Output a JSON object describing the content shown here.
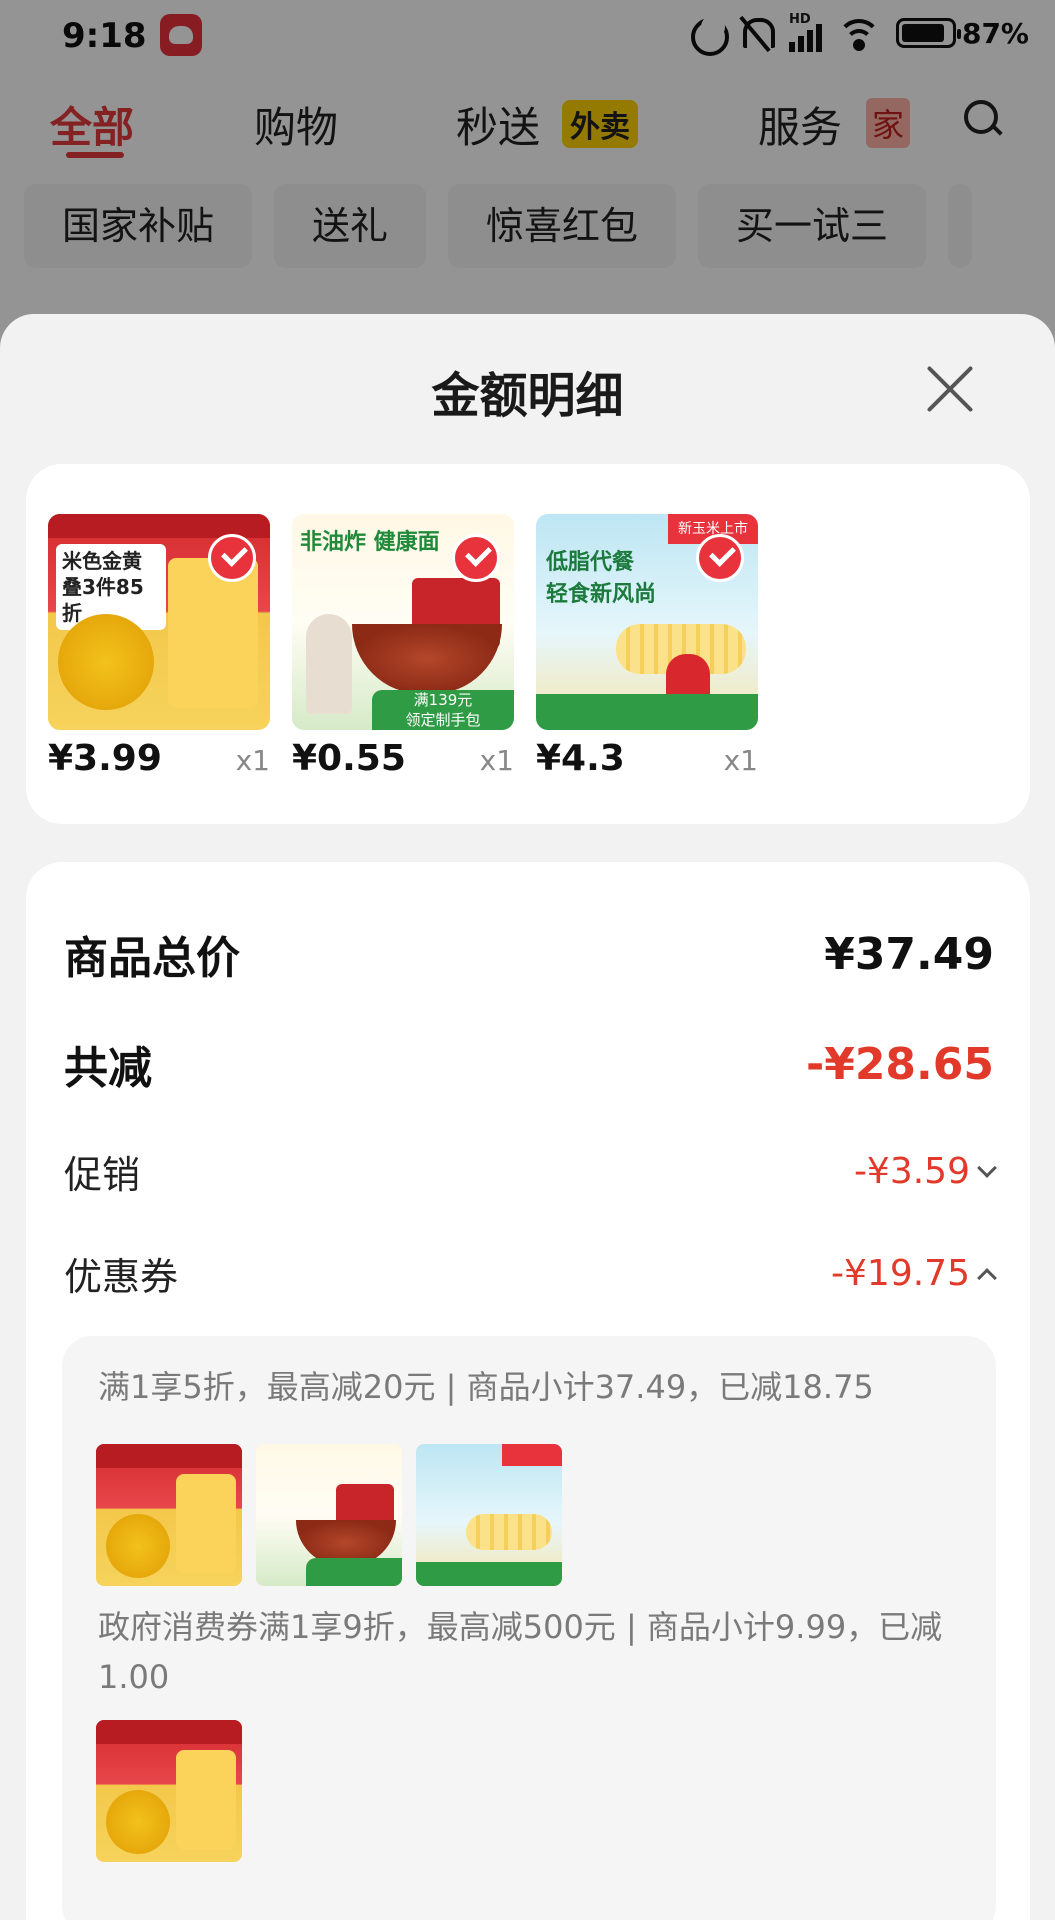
{
  "status_bar": {
    "time": "9:18",
    "network": "HD",
    "battery": "87%",
    "battery_level": 0.87
  },
  "top_tabs": [
    {
      "label": "全部",
      "active": true
    },
    {
      "label": "购物",
      "active": false
    },
    {
      "label": "秒送",
      "active": false,
      "tag": "外卖"
    },
    {
      "label": "服务",
      "active": false,
      "tag": "家"
    }
  ],
  "filter_chips": [
    "国家补贴",
    "送礼",
    "惊喜红包",
    "买一试三"
  ],
  "sheet": {
    "title": "金额明细",
    "products": [
      {
        "price": "¥3.99",
        "qty": "x1",
        "thumb_text": "米色金黄\n叠3件85折",
        "checked": true
      },
      {
        "price": "¥0.55",
        "qty": "x1",
        "thumb_text": "非油炸 健康面",
        "band_text": "满139元\n领定制手包",
        "checked": true
      },
      {
        "price": "¥4.3",
        "qty": "x1",
        "thumb_text": "低脂代餐\n轻食新风尚",
        "tag_text": "新玉米上市",
        "checked": true
      }
    ],
    "summary": {
      "total_label": "商品总价",
      "total_value": "¥37.49",
      "reduce_label": "共减",
      "reduce_value": "-¥28.65",
      "promo_label": "促销",
      "promo_value": "-¥3.59",
      "coupon_label": "优惠券",
      "coupon_value": "-¥19.75"
    },
    "coupons": [
      {
        "desc": "满1享5折，最高减20元 | 商品小计37.49，已减18.75"
      },
      {
        "desc": "政府消费券满1享9折，最高减500元 | 商品小计9.99，已减1.00"
      }
    ]
  },
  "colors": {
    "accent": "#e4393c",
    "discount": "#e23a2a"
  }
}
